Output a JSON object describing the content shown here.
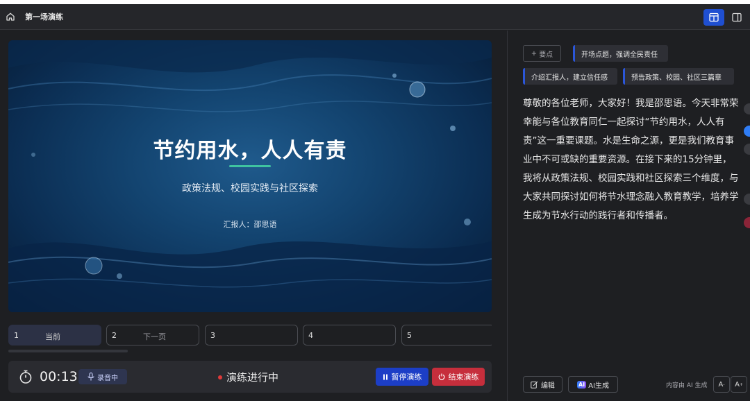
{
  "header": {
    "title": "第一场演练",
    "home_icon": "home-icon",
    "layout_icons": [
      "layout-single-icon",
      "layout-split-icon"
    ],
    "accent": "#1f4fd1"
  },
  "slide": {
    "title": "节约用水，人人有责",
    "subtitle": "政策法规、校园实践与社区探索",
    "presenter": "汇报人：邵思语"
  },
  "thumbnails": [
    {
      "num": "1",
      "label": "当前"
    },
    {
      "num": "2",
      "label": "下一页"
    },
    {
      "num": "3",
      "label": ""
    },
    {
      "num": "4",
      "label": ""
    },
    {
      "num": "5",
      "label": ""
    }
  ],
  "controls": {
    "timer": "00:13",
    "record_label": "录音中",
    "status": "演练进行中",
    "pause_label": "暂停演练",
    "end_label": "结束演练",
    "pause_color": "#1c3ec6",
    "end_color": "#c62e3c"
  },
  "points": {
    "add_label": "要点",
    "items": [
      "开场点题，强调全民责任",
      "介绍汇报人，建立信任感",
      "预告政策、校园、社区三篇章"
    ]
  },
  "script": {
    "text": "尊敬的各位老师，大家好！我是邵思语。今天非常荣幸能与各位教育同仁一起探讨“节约用水，人人有责”这一重要课题。水是生命之源，更是我们教育事业中不可或缺的重要资源。在接下来的15分钟里，我将从政策法规、校园实践和社区探索三个维度，与大家共同探讨如何将节水理念融入教育教学，培养学生成为节水行动的践行者和传播者。"
  },
  "footer": {
    "edit_label": "编辑",
    "ai_badge": "AI",
    "ai_label": "AI生成",
    "note": "内容由 AI 生成",
    "font_buttons": [
      "A",
      "A"
    ]
  }
}
